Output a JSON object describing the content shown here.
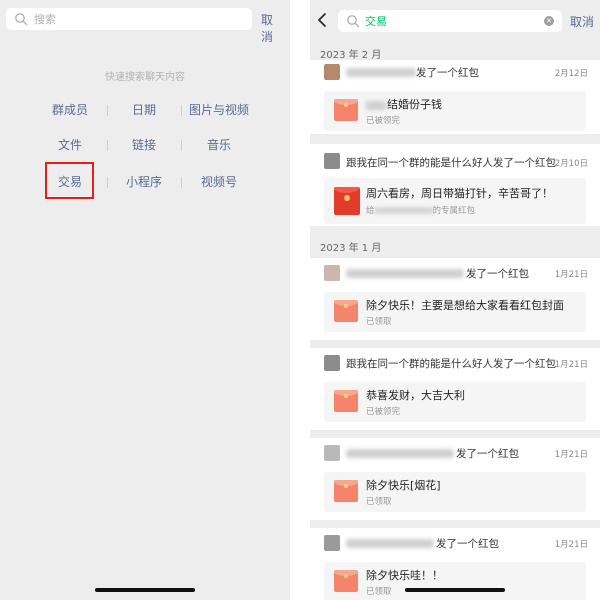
{
  "left": {
    "search_placeholder": "搜索",
    "cancel": "取消",
    "quick_title": "快速搜索聊天内容",
    "grid": [
      [
        "群成员",
        "日期",
        "图片与视频"
      ],
      [
        "文件",
        "链接",
        "音乐"
      ],
      [
        "交易",
        "小程序",
        "视频号"
      ]
    ],
    "highlight_color": "#e0201b",
    "link_color": "#576b95"
  },
  "right": {
    "query": "交易",
    "cancel": "取消",
    "query_color": "#07c160",
    "sections": [
      {
        "title": "2023 年 2 月",
        "items": [
          {
            "sender_suffix": "发了一个红包",
            "date": "2月12日",
            "title_visible": "结婚份子钱",
            "status": "已被领完"
          },
          {
            "sender_suffix": "跟我在同一个群的能是什么好人发了一个红包",
            "date": "2月10日",
            "title_visible": "周六看房，周日带猫打针，辛苦哥了！",
            "status_prefix": "给",
            "status_suffix": "的专属红包"
          }
        ]
      },
      {
        "title": "2023 年 1 月",
        "items": [
          {
            "sender_suffix": "发了一个红包",
            "date": "1月21日",
            "title_visible": "除夕快乐！主要是想给大家看看红包封面",
            "status": "已领取"
          },
          {
            "sender_suffix": "跟我在同一个群的能是什么好人发了一个红包",
            "date": "1月21日",
            "title_visible": "恭喜发财，大吉大利",
            "status": "已被领完"
          },
          {
            "sender_suffix": "发了一个红包",
            "date": "1月21日",
            "title_visible": "除夕快乐[烟花]",
            "status": "已领取"
          },
          {
            "sender_suffix": "发了一个红包",
            "date": "1月21日",
            "title_visible": "除夕快乐哇！！",
            "status": "已领取"
          }
        ]
      }
    ]
  }
}
